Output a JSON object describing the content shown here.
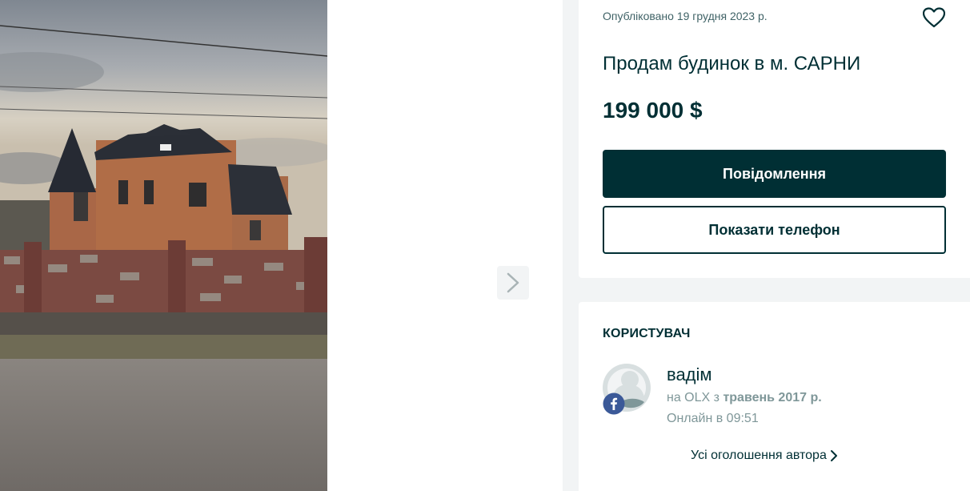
{
  "offer": {
    "published": "Опубліковано 19 грудня 2023 р.",
    "title": "Продам будинок в м. САРНИ",
    "price": "199 000 $",
    "message_button": "Повідомлення",
    "phone_button": "Показати телефон"
  },
  "user": {
    "section_title": "Користувач",
    "name": "вадім",
    "member_prefix": "на OLX з",
    "member_since": "травень 2017 р.",
    "online": "Онлайн в 09:51",
    "all_ads_link": "Усі оголошення автора"
  },
  "icons": {
    "favorite": "heart-outline-icon",
    "next": "chevron-right-icon",
    "social": "facebook-icon"
  },
  "colors": {
    "primary": "#002f34",
    "background": "#f2f4f5",
    "muted": "#7f9799",
    "facebook": "#3b5998"
  }
}
